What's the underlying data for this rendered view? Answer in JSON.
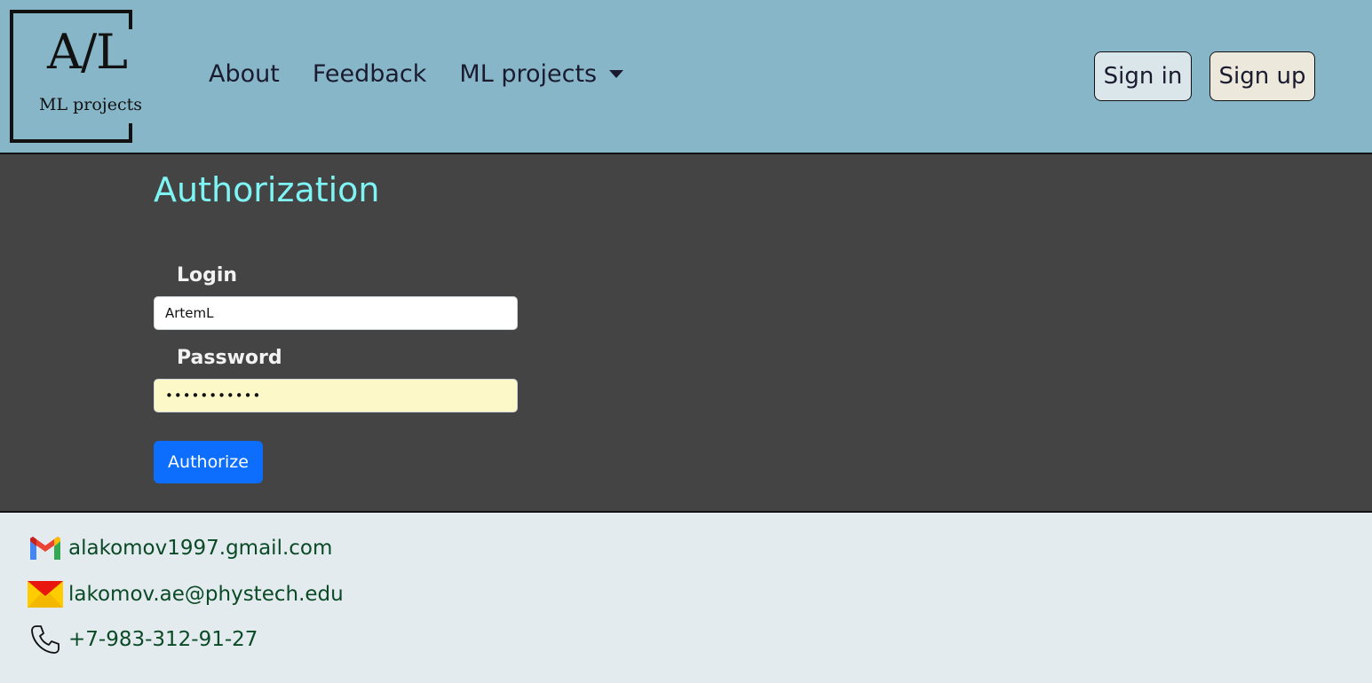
{
  "header": {
    "logo": {
      "main": "A/L",
      "sub": "ML projects"
    },
    "nav": [
      {
        "label": "About"
      },
      {
        "label": "Feedback"
      },
      {
        "label": "ML projects",
        "dropdown": true
      }
    ],
    "sign_in": "Sign in",
    "sign_up": "Sign up"
  },
  "main": {
    "title": "Authorization",
    "login_label": "Login",
    "login_value": "ArtemL",
    "password_label": "Password",
    "password_value": "•••••••••••",
    "submit_label": "Authorize"
  },
  "footer": {
    "contacts": [
      {
        "icon": "gmail-icon",
        "text": "alakomov1997.gmail.com"
      },
      {
        "icon": "mail-envelope-icon",
        "text": "lakomov.ae@phystech.edu"
      },
      {
        "icon": "phone-icon",
        "text": "+7-983-312-91-27"
      }
    ]
  },
  "colors": {
    "header_bg": "#88b6c9",
    "main_bg": "#444444",
    "footer_bg": "#e3ebef",
    "title": "#7ff4f4",
    "primary_button": "#0d6efd",
    "link": "#0b4a26"
  }
}
